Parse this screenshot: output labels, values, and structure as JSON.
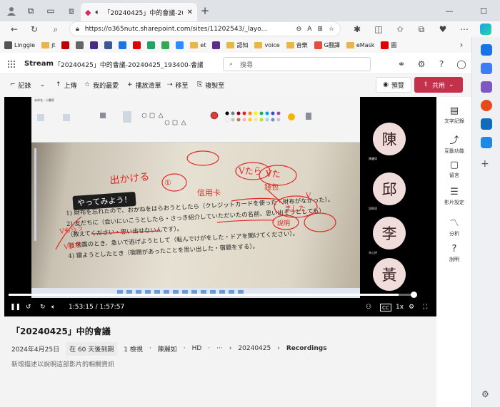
{
  "browser": {
    "tab_title": "「20240425」中的會議-2024",
    "url": "https://o365nutc.sharepoint.com/sites/11202543/_layo...",
    "new_tab_symbol": "+"
  },
  "bookmarks": [
    {
      "label": "Linggle",
      "color": "#555555",
      "type": "icon"
    },
    {
      "label": "jt",
      "type": "folder"
    },
    {
      "label": "",
      "color": "#c00000",
      "type": "icon"
    },
    {
      "label": "",
      "color": "#666666",
      "type": "icon"
    },
    {
      "label": "",
      "color": "#4b2a8c",
      "type": "icon"
    },
    {
      "label": "",
      "color": "#3b5998",
      "type": "icon"
    },
    {
      "label": "",
      "color": "#1b73e8",
      "type": "icon"
    },
    {
      "label": "",
      "color": "#e00000",
      "type": "icon"
    },
    {
      "label": "",
      "color": "#1fa463",
      "type": "icon"
    },
    {
      "label": "",
      "color": "#34a853",
      "type": "icon"
    },
    {
      "label": "",
      "color": "#2d8cff",
      "type": "icon"
    },
    {
      "label": "et",
      "type": "folder"
    },
    {
      "label": "",
      "color": "#5c2d91",
      "type": "icon"
    },
    {
      "label": "認知",
      "type": "folder"
    },
    {
      "label": "voice",
      "type": "folder"
    },
    {
      "label": "音樂",
      "type": "folder"
    },
    {
      "label": "G翻譯",
      "color": "#e84c3d",
      "type": "icon"
    },
    {
      "label": "eMask",
      "type": "folder"
    },
    {
      "label": "圖",
      "color": "#e00000",
      "type": "icon"
    }
  ],
  "stream": {
    "app_name": "Stream",
    "breadcrumb": "「20240425」中的會議-20240425_193400-會議...",
    "search_placeholder": "搜尋",
    "commands": {
      "record": "記錄",
      "upload": "上傳",
      "favorite": "我的最愛",
      "add_playlist": "播放清單",
      "move": "移至",
      "copy": "複製至",
      "preview": "預覽",
      "share": "共用"
    }
  },
  "video": {
    "current_time": "1:53:15",
    "total_time": "1:57:57",
    "progress": 0.96,
    "speed": "1x",
    "cc": "CC",
    "paint_title": "未命名 - 小畫家",
    "overlay_label": "やってみよう！",
    "participants": [
      {
        "initial": "陳",
        "name": "陳儷如"
      },
      {
        "initial": "邱",
        "name": "邱郁瑄"
      },
      {
        "initial": "李",
        "name": "李心妤"
      },
      {
        "initial": "黃",
        "name": ""
      }
    ],
    "book_lines": [
      "1) 財布を忘れたので、おかねをはらおうとしたら（クレジットカードを使った・財布がなかった）。",
      "2) 友だちに（会いにいこうとしたら・さっき紹介していただいたの名前、思い出そうとしても）",
      "（教えてください・思い出せないんです）。",
      "3) 地震のとき、急いで逃げようとして（転んでけがをした・ドアを開けてください）。",
      "4) 寝ようとしたとき（宿題があったことを思い出した・宿題をする）。"
    ],
    "ink_labels": [
      "出かける",
      "①",
      "たら",
      "た",
      "信用卡",
      "錢包",
      "ました",
      "說明",
      "Vもらう",
      "V要求",
      "Vたら"
    ]
  },
  "details": {
    "title": "「20240425」中的會議",
    "date": "2024年4月25日",
    "expires": "在 60 天後到期",
    "views": "1 檢視",
    "owner": "陳麗如",
    "quality": "HD",
    "more": "···",
    "breadcrumb_folder": "20240425",
    "breadcrumb_current": "Recordings",
    "description_placeholder": "新增描述以說明這部影片的相關資訊"
  },
  "right_panel": [
    {
      "icon": "transcript-icon",
      "glyph": "▤",
      "label": "文字記錄"
    },
    {
      "icon": "interactive-icon",
      "glyph": "⤴",
      "label": "互動功能"
    },
    {
      "icon": "comment-icon",
      "glyph": "▢",
      "label": "留言"
    },
    {
      "icon": "settings-sliders-icon",
      "glyph": "☰",
      "label": "影片設定"
    },
    {
      "icon": "analytics-icon",
      "glyph": "〽",
      "label": "分析"
    },
    {
      "icon": "help-icon",
      "glyph": "?",
      "label": "說明"
    }
  ],
  "colors": {
    "share_button": "#c4314b",
    "ink": "#e02a2a",
    "avatar_bg": "#f1dcdc"
  }
}
